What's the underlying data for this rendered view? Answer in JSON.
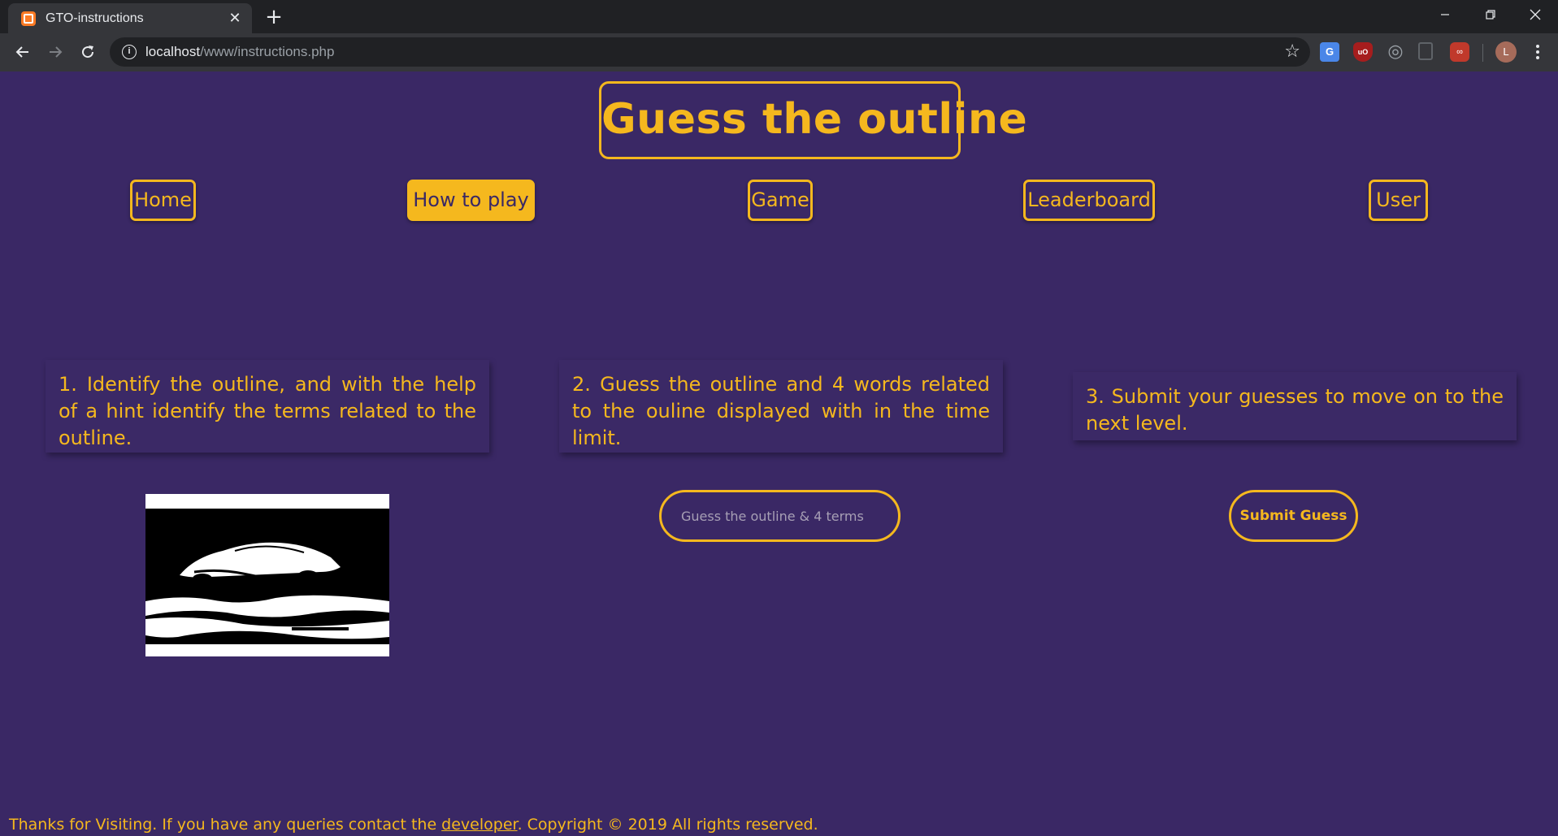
{
  "browser": {
    "tab_title": "GTO-instructions",
    "new_tab_symbol": "+",
    "url_host": "localhost",
    "url_path": "/www/instructions.php",
    "avatar_letter": "L",
    "icons": [
      "xampp-favicon-icon",
      "close-icon",
      "plus-icon",
      "minimize-icon",
      "maximize-icon",
      "window-close-icon",
      "back-arrow-icon",
      "forward-arrow-icon",
      "reload-icon",
      "info-icon",
      "star-icon",
      "translate-extension-icon",
      "ublock-extension-icon",
      "target-extension-icon",
      "extension-icon",
      "multi-extension-icon",
      "kebab-menu-icon"
    ]
  },
  "site": {
    "title": "Guess the outline",
    "accent_color": "#f5b81e",
    "background_color": "#3a2865"
  },
  "nav": {
    "items": [
      {
        "label": "Home",
        "active": false
      },
      {
        "label": "How to play",
        "active": true
      },
      {
        "label": "Game",
        "active": false
      },
      {
        "label": "Leaderboard",
        "active": false
      },
      {
        "label": "User",
        "active": false
      }
    ]
  },
  "steps": [
    {
      "text": "1. Identify the outline, and with the help of a hint identify the terms related to the outline."
    },
    {
      "text": "2. Guess the outline and 4 words related to the ouline displayed with in the time limit."
    },
    {
      "text": "3. Submit your guesses to move on to the next level."
    }
  ],
  "example": {
    "image_subject": "car-outline-image"
  },
  "guess": {
    "placeholder": "Guess the outline & 4 terms",
    "value": ""
  },
  "submit": {
    "label": "Submit Guess"
  },
  "footer": {
    "before_link": "Thanks for Visiting. If you have any queries contact the ",
    "link_text": "developer",
    "after_link": ". Copyright © 2019 All rights reserved."
  }
}
